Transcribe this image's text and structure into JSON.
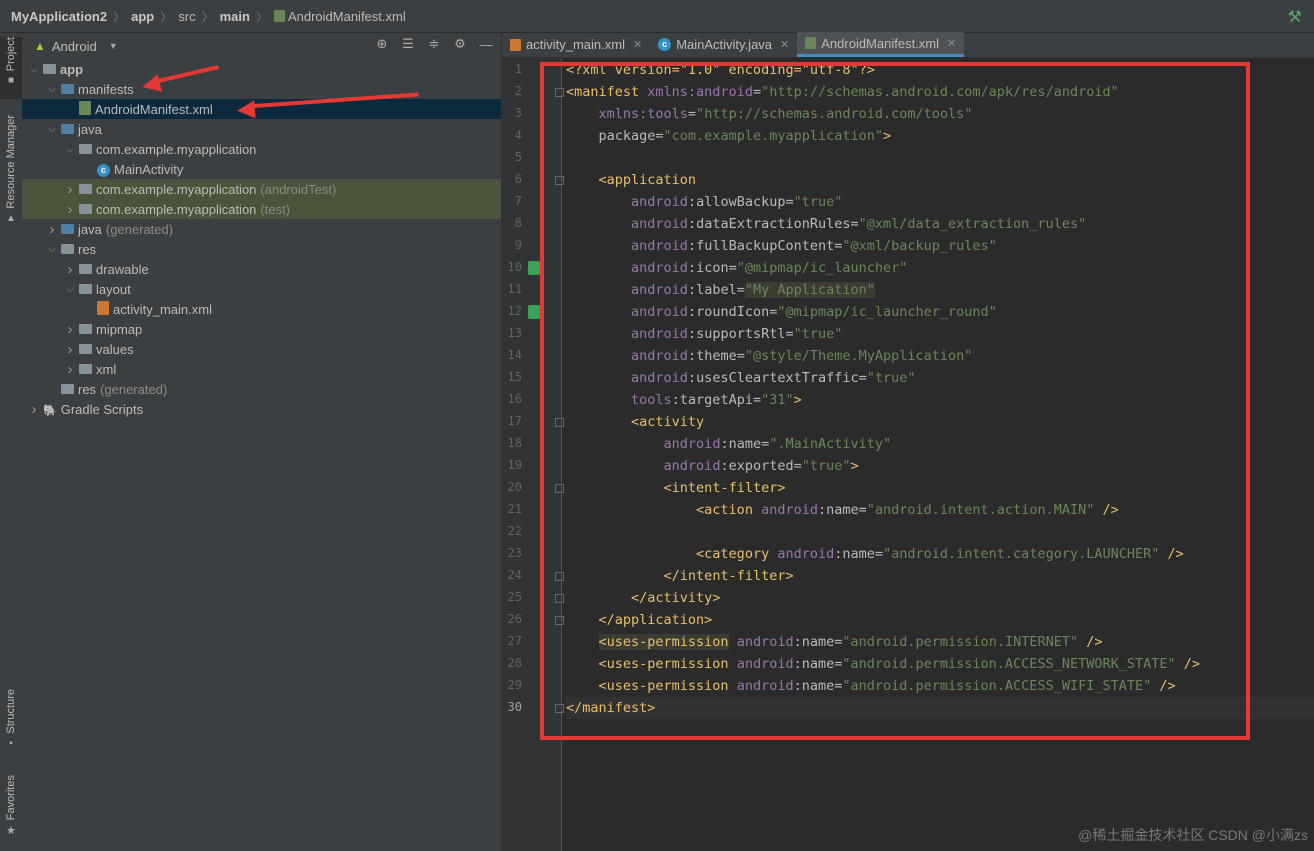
{
  "breadcrumb": [
    "MyApplication2",
    "app",
    "src",
    "main",
    "AndroidManifest.xml"
  ],
  "left_strip": [
    "Project",
    "Resource Manager",
    "Structure",
    "Favorites"
  ],
  "project_panel": {
    "view_label": "Android",
    "tree": [
      {
        "label": "app",
        "muted": "",
        "kind": "folder",
        "indent": 0,
        "expanded": true,
        "style": "bold"
      },
      {
        "label": "manifests",
        "muted": "",
        "kind": "folder-blue",
        "indent": 1,
        "expanded": true
      },
      {
        "label": "AndroidManifest.xml",
        "muted": "",
        "kind": "manifest",
        "indent": 2,
        "selected": true
      },
      {
        "label": "java",
        "muted": "",
        "kind": "folder-blue",
        "indent": 1,
        "expanded": true
      },
      {
        "label": "com.example.myapplication",
        "muted": "",
        "kind": "folder",
        "indent": 2,
        "expanded": true
      },
      {
        "label": "MainActivity",
        "muted": "",
        "kind": "class",
        "indent": 3
      },
      {
        "label": "com.example.myapplication",
        "muted": "(androidTest)",
        "kind": "folder",
        "indent": 2,
        "expanded": false,
        "test": true
      },
      {
        "label": "com.example.myapplication",
        "muted": "(test)",
        "kind": "folder",
        "indent": 2,
        "expanded": false,
        "test": true
      },
      {
        "label": "java",
        "muted": "(generated)",
        "kind": "folder-blue",
        "indent": 1,
        "expanded": false
      },
      {
        "label": "res",
        "muted": "",
        "kind": "folder",
        "indent": 1,
        "expanded": true
      },
      {
        "label": "drawable",
        "muted": "",
        "kind": "folder",
        "indent": 2,
        "expanded": false
      },
      {
        "label": "layout",
        "muted": "",
        "kind": "folder",
        "indent": 2,
        "expanded": true
      },
      {
        "label": "activity_main.xml",
        "muted": "",
        "kind": "layoutxml",
        "indent": 3
      },
      {
        "label": "mipmap",
        "muted": "",
        "kind": "folder",
        "indent": 2,
        "expanded": false
      },
      {
        "label": "values",
        "muted": "",
        "kind": "folder",
        "indent": 2,
        "expanded": false
      },
      {
        "label": "xml",
        "muted": "",
        "kind": "folder",
        "indent": 2,
        "expanded": false
      },
      {
        "label": "res",
        "muted": "(generated)",
        "kind": "folder",
        "indent": 1
      },
      {
        "label": "Gradle Scripts",
        "muted": "",
        "kind": "gradle",
        "indent": 0,
        "expanded": false
      }
    ]
  },
  "editor_tabs": [
    {
      "label": "activity_main.xml",
      "icon": "layout-xml-icon",
      "active": false
    },
    {
      "label": "MainActivity.java",
      "icon": "class-icon",
      "active": false
    },
    {
      "label": "AndroidManifest.xml",
      "icon": "manifest-icon",
      "active": true
    }
  ],
  "code_lines": [
    [
      [
        "pi",
        "<?xml version=\"1.0\" encoding=\"utf-8\"?>"
      ]
    ],
    [
      [
        "tag",
        "<manifest "
      ],
      [
        "ns",
        "xmlns:android"
      ],
      [
        "attr",
        "="
      ],
      [
        "val",
        "\"http://schemas.android.com/apk/res/android\""
      ]
    ],
    [
      [
        "attr",
        "    "
      ],
      [
        "ns",
        "xmlns:tools"
      ],
      [
        "attr",
        "="
      ],
      [
        "val",
        "\"http://schemas.android.com/tools\""
      ]
    ],
    [
      [
        "attr",
        "    package="
      ],
      [
        "val",
        "\"com.example.myapplication\""
      ],
      [
        "tag",
        ">"
      ]
    ],
    [],
    [
      [
        "attr",
        "    "
      ],
      [
        "tag",
        "<application"
      ]
    ],
    [
      [
        "attr",
        "        "
      ],
      [
        "ns",
        "android"
      ],
      [
        "attr",
        ":allowBackup="
      ],
      [
        "val",
        "\"true\""
      ]
    ],
    [
      [
        "attr",
        "        "
      ],
      [
        "ns",
        "android"
      ],
      [
        "attr",
        ":dataExtractionRules="
      ],
      [
        "val",
        "\"@xml/data_extraction_rules\""
      ]
    ],
    [
      [
        "attr",
        "        "
      ],
      [
        "ns",
        "android"
      ],
      [
        "attr",
        ":fullBackupContent="
      ],
      [
        "val",
        "\"@xml/backup_rules\""
      ]
    ],
    [
      [
        "attr",
        "        "
      ],
      [
        "ns",
        "android"
      ],
      [
        "attr",
        ":icon="
      ],
      [
        "val",
        "\"@mipmap/ic_launcher\""
      ]
    ],
    [
      [
        "attr",
        "        "
      ],
      [
        "ns",
        "android"
      ],
      [
        "attr",
        ":label="
      ],
      [
        "valhl",
        "\"My Application\""
      ]
    ],
    [
      [
        "attr",
        "        "
      ],
      [
        "ns",
        "android"
      ],
      [
        "attr",
        ":roundIcon="
      ],
      [
        "val",
        "\"@mipmap/ic_launcher_round\""
      ]
    ],
    [
      [
        "attr",
        "        "
      ],
      [
        "ns",
        "android"
      ],
      [
        "attr",
        ":supportsRtl="
      ],
      [
        "val",
        "\"true\""
      ]
    ],
    [
      [
        "attr",
        "        "
      ],
      [
        "ns",
        "android"
      ],
      [
        "attr",
        ":theme="
      ],
      [
        "val",
        "\"@style/Theme.MyApplication\""
      ]
    ],
    [
      [
        "attr",
        "        "
      ],
      [
        "ns",
        "android"
      ],
      [
        "attr",
        ":usesCleartextTraffic="
      ],
      [
        "val",
        "\"true\""
      ]
    ],
    [
      [
        "attr",
        "        "
      ],
      [
        "ns",
        "tools"
      ],
      [
        "attr",
        ":targetApi="
      ],
      [
        "val",
        "\"31\""
      ],
      [
        "tag",
        ">"
      ]
    ],
    [
      [
        "attr",
        "        "
      ],
      [
        "tag",
        "<activity"
      ]
    ],
    [
      [
        "attr",
        "            "
      ],
      [
        "ns",
        "android"
      ],
      [
        "attr",
        ":name="
      ],
      [
        "val",
        "\".MainActivity\""
      ]
    ],
    [
      [
        "attr",
        "            "
      ],
      [
        "ns",
        "android"
      ],
      [
        "attr",
        ":exported="
      ],
      [
        "val",
        "\"true\""
      ],
      [
        "tag",
        ">"
      ]
    ],
    [
      [
        "attr",
        "            "
      ],
      [
        "tag",
        "<intent-filter>"
      ]
    ],
    [
      [
        "attr",
        "                "
      ],
      [
        "tag",
        "<action "
      ],
      [
        "ns",
        "android"
      ],
      [
        "attr",
        ":name="
      ],
      [
        "val",
        "\"android.intent.action.MAIN\""
      ],
      [
        "tag",
        " />"
      ]
    ],
    [],
    [
      [
        "attr",
        "                "
      ],
      [
        "tag",
        "<category "
      ],
      [
        "ns",
        "android"
      ],
      [
        "attr",
        ":name="
      ],
      [
        "val",
        "\"android.intent.category.LAUNCHER\""
      ],
      [
        "tag",
        " />"
      ]
    ],
    [
      [
        "attr",
        "            "
      ],
      [
        "tag",
        "</intent-filter>"
      ]
    ],
    [
      [
        "attr",
        "        "
      ],
      [
        "tag",
        "</activity>"
      ]
    ],
    [
      [
        "attr",
        "    "
      ],
      [
        "tag",
        "</application>"
      ]
    ],
    [
      [
        "attr",
        "    "
      ],
      [
        "taghl",
        "<uses-permission"
      ],
      [
        "attr",
        " "
      ],
      [
        "ns",
        "android"
      ],
      [
        "attr",
        ":name="
      ],
      [
        "val",
        "\"android.permission.INTERNET\""
      ],
      [
        "tag",
        " />"
      ]
    ],
    [
      [
        "attr",
        "    "
      ],
      [
        "tag",
        "<uses-permission "
      ],
      [
        "ns",
        "android"
      ],
      [
        "attr",
        ":name="
      ],
      [
        "val",
        "\"android.permission.ACCESS_NETWORK_STATE\""
      ],
      [
        "tag",
        " />"
      ]
    ],
    [
      [
        "attr",
        "    "
      ],
      [
        "tag",
        "<uses-permission "
      ],
      [
        "ns",
        "android"
      ],
      [
        "attr",
        ":name="
      ],
      [
        "val",
        "\"android.permission.ACCESS_WIFI_STATE\""
      ],
      [
        "tag",
        " />"
      ]
    ],
    [
      [
        "tag",
        "</manifest>"
      ]
    ]
  ],
  "current_line": 30,
  "gutter_marks": [
    10,
    12
  ],
  "watermark": "@稀土掘金技术社区 CSDN @小满zs"
}
